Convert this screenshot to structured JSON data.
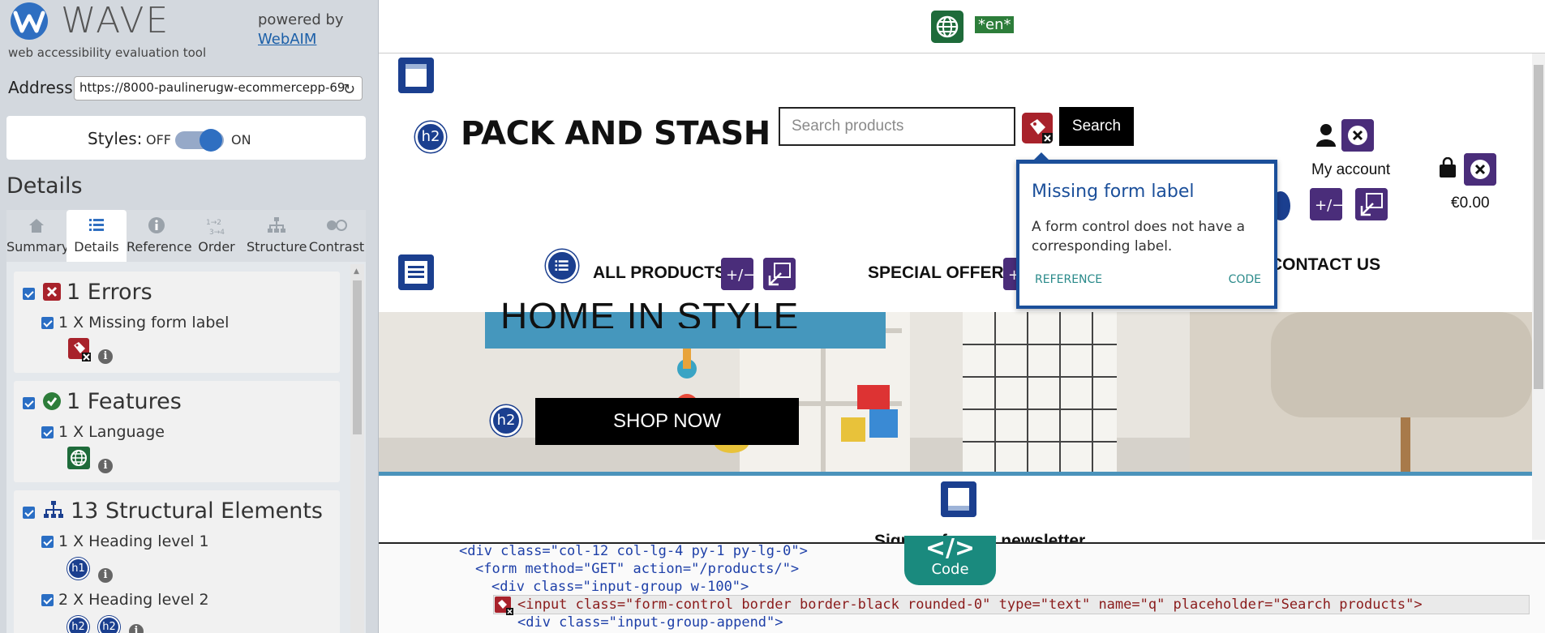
{
  "sidebar": {
    "logo_text": "WAVE",
    "tagline": "web accessibility evaluation tool",
    "powered_by": "powered by",
    "powered_link": "WebAIM",
    "address_label": "Address:",
    "address_value": "https://8000-paulinerugw-ecommercepp-69",
    "styles_label": "Styles:",
    "styles_off": "OFF",
    "styles_on": "ON",
    "details_heading": "Details",
    "tabs": [
      {
        "label": "Summary",
        "icon": "home-icon"
      },
      {
        "label": "Details",
        "icon": "list-icon"
      },
      {
        "label": "Reference",
        "icon": "info-icon"
      },
      {
        "label": "Order",
        "icon": "order-icon"
      },
      {
        "label": "Structure",
        "icon": "structure-icon"
      },
      {
        "label": "Contrast",
        "icon": "contrast-icon"
      }
    ],
    "errors": {
      "title": "1 Errors",
      "items": [
        {
          "label": "1 X Missing form label"
        }
      ]
    },
    "features": {
      "title": "1 Features",
      "items": [
        {
          "label": "1 X Language"
        }
      ]
    },
    "structure": {
      "title": "13 Structural Elements",
      "items": [
        {
          "label": "1 X Heading level 1",
          "badge": "h1"
        },
        {
          "label": "2 X Heading level 2",
          "badge": "h2"
        }
      ]
    }
  },
  "page": {
    "lang_tag": "*en*",
    "brand": "PACK AND STASH",
    "search_placeholder": "Search products",
    "search_button": "Search",
    "my_account": "My account",
    "price": "€0.00",
    "nav": {
      "all_products": "ALL PRODUCTS",
      "special_offers": "SPECIAL OFFERS",
      "contact": "CONTACT US"
    },
    "hero_text": "HOME IN STYLE",
    "shop_now": "SHOP NOW",
    "newsletter": "Sign up for our newsletter",
    "h2": "h2"
  },
  "tooltip": {
    "title": "Missing form label",
    "body": "A form control does not have a corresponding label.",
    "reference": "REFERENCE",
    "code": "CODE"
  },
  "code_panel": {
    "tab_symbol": "</>",
    "tab_label": "Code",
    "lines": [
      "<div class=\"col-12 col-lg-4 py-1 py-lg-0\">",
      "<form method=\"GET\" action=\"/products/\">",
      "<div class=\"input-group w-100\">",
      "<input class=\"form-control border border-black rounded-0\" type=\"text\" name=\"q\" placeholder=\"Search products\">",
      "<div class=\"input-group-append\">"
    ]
  },
  "colors": {
    "error": "#a8222b",
    "feature": "#1e6b3a",
    "structure": "#1b3f8f",
    "aria": "#4a2d7a",
    "accent": "#2f6fc1"
  }
}
